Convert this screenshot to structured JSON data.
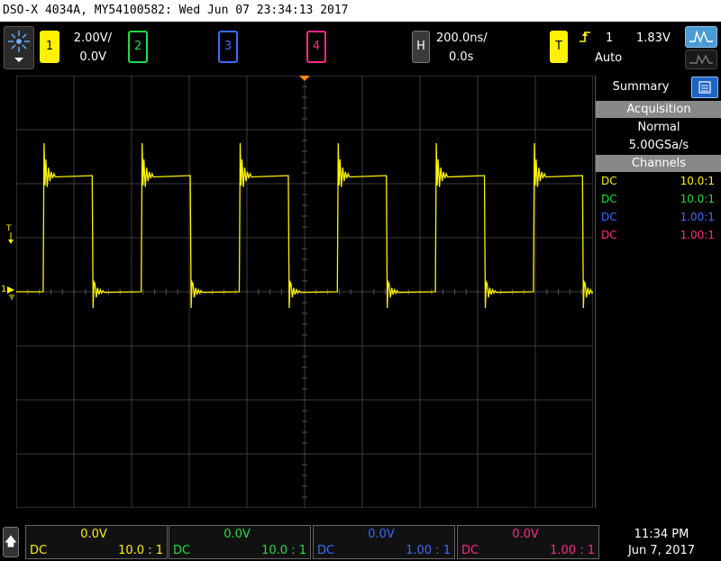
{
  "window": {
    "title": "DSO-X 4034A, MY54100582: Wed Jun 07 23:34:13 2017"
  },
  "channels": [
    {
      "num": "1",
      "color": "#fff200",
      "scale": "2.00V/",
      "offset": "0.0V",
      "coupling": "DC",
      "probe": "10.0 : 1",
      "probe_side": "10.0:1"
    },
    {
      "num": "2",
      "color": "#22dd44",
      "scale": "",
      "offset": "0.0V",
      "coupling": "DC",
      "probe": "10.0 : 1",
      "probe_side": "10.0:1"
    },
    {
      "num": "3",
      "color": "#3a6cff",
      "scale": "",
      "offset": "0.0V",
      "coupling": "DC",
      "probe": "1.00 : 1",
      "probe_side": "1.00:1"
    },
    {
      "num": "4",
      "color": "#ff2a8a",
      "scale": "",
      "offset": "0.0V",
      "coupling": "DC",
      "probe": "1.00 : 1",
      "probe_side": "1.00:1"
    }
  ],
  "horizontal": {
    "label": "H",
    "timebase": "200.0ns/",
    "delay": "0.0s"
  },
  "trigger": {
    "label": "T",
    "slope_icon": "rising-edge-icon",
    "source": "1",
    "level": "1.83V",
    "mode": "Auto"
  },
  "sidebar": {
    "tab_summary": "Summary",
    "acq_header": "Acquisition",
    "acq_mode": "Normal",
    "sample_rate": "5.00GSa/s",
    "channels_header": "Channels"
  },
  "markers": {
    "trigger_level": "T",
    "ch1_ground": "1"
  },
  "status": {
    "time": "11:34 PM",
    "date": "Jun 7, 2017"
  },
  "waveform": {
    "channel": "1",
    "shape": "square",
    "period_divisions": 1.7,
    "high_volts": 4.3,
    "low_volts": 0.0,
    "overshoot_volts": 1.2
  },
  "colors": {
    "grid": "#3c3c3c",
    "trace": "#fff200",
    "panel_header": "#888888",
    "selected": "#4a9ad4"
  }
}
